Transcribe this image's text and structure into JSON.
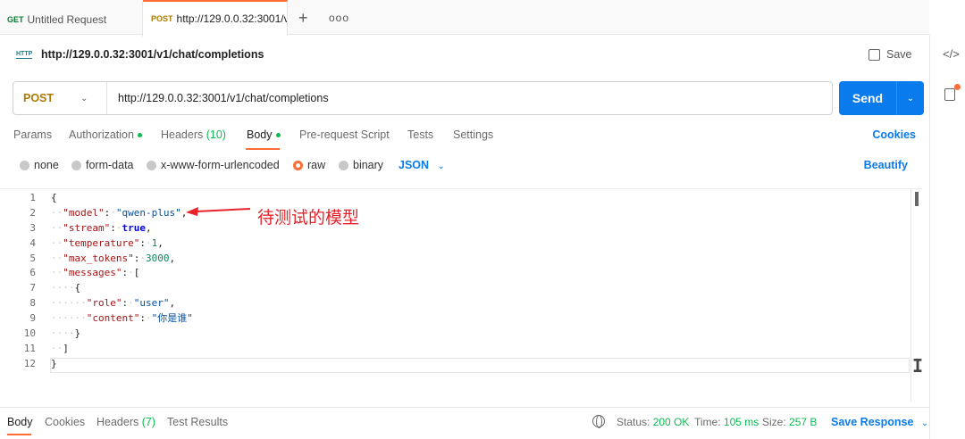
{
  "tabs": [
    {
      "method": "GET",
      "label": "Untitled Request"
    },
    {
      "method": "POST",
      "label": "http://129.0.0.32:3001/v"
    }
  ],
  "tab_add": "+",
  "tab_more": "ooo",
  "request": {
    "icon_text": "HTTP",
    "title": "http://129.0.0.32:3001/v1/chat/completions",
    "save_label": "Save",
    "method": "POST",
    "url": "http://129.0.0.32:3001/v1/chat/completions",
    "send_label": "Send"
  },
  "request_tabs": [
    {
      "label": "Params"
    },
    {
      "label": "Authorization"
    },
    {
      "label": "Headers",
      "count": "(10)"
    },
    {
      "label": "Body"
    },
    {
      "label": "Pre-request Script"
    },
    {
      "label": "Tests"
    },
    {
      "label": "Settings"
    }
  ],
  "cookies_label": "Cookies",
  "body_options": [
    "none",
    "form-data",
    "x-www-form-urlencoded",
    "raw",
    "binary"
  ],
  "body_format": "JSON",
  "beautify_label": "Beautify",
  "line_numbers": [
    "1",
    "2",
    "3",
    "4",
    "5",
    "6",
    "7",
    "8",
    "9",
    "10",
    "11",
    "12"
  ],
  "json_body": {
    "model": "qwen-plus",
    "stream": "true",
    "temperature": "1",
    "max_tokens": "3000",
    "messages_role": "user",
    "messages_content": "你是谁"
  },
  "annotation": "待测试的模型",
  "response_tabs": [
    {
      "label": "Body"
    },
    {
      "label": "Cookies"
    },
    {
      "label": "Headers",
      "count": "(7)"
    },
    {
      "label": "Test Results"
    }
  ],
  "response_stats": {
    "status_label": "Status:",
    "status_value": "200 OK",
    "time_label": "Time:",
    "time_value": "105 ms",
    "size_label": "Size:",
    "size_value": "257 B"
  },
  "save_response_label": "Save Response",
  "colors": {
    "accent": "#ff6c37",
    "primary": "#097bed",
    "success": "#0cbb52",
    "post": "#ad7a03",
    "annotation": "#e8232b"
  }
}
